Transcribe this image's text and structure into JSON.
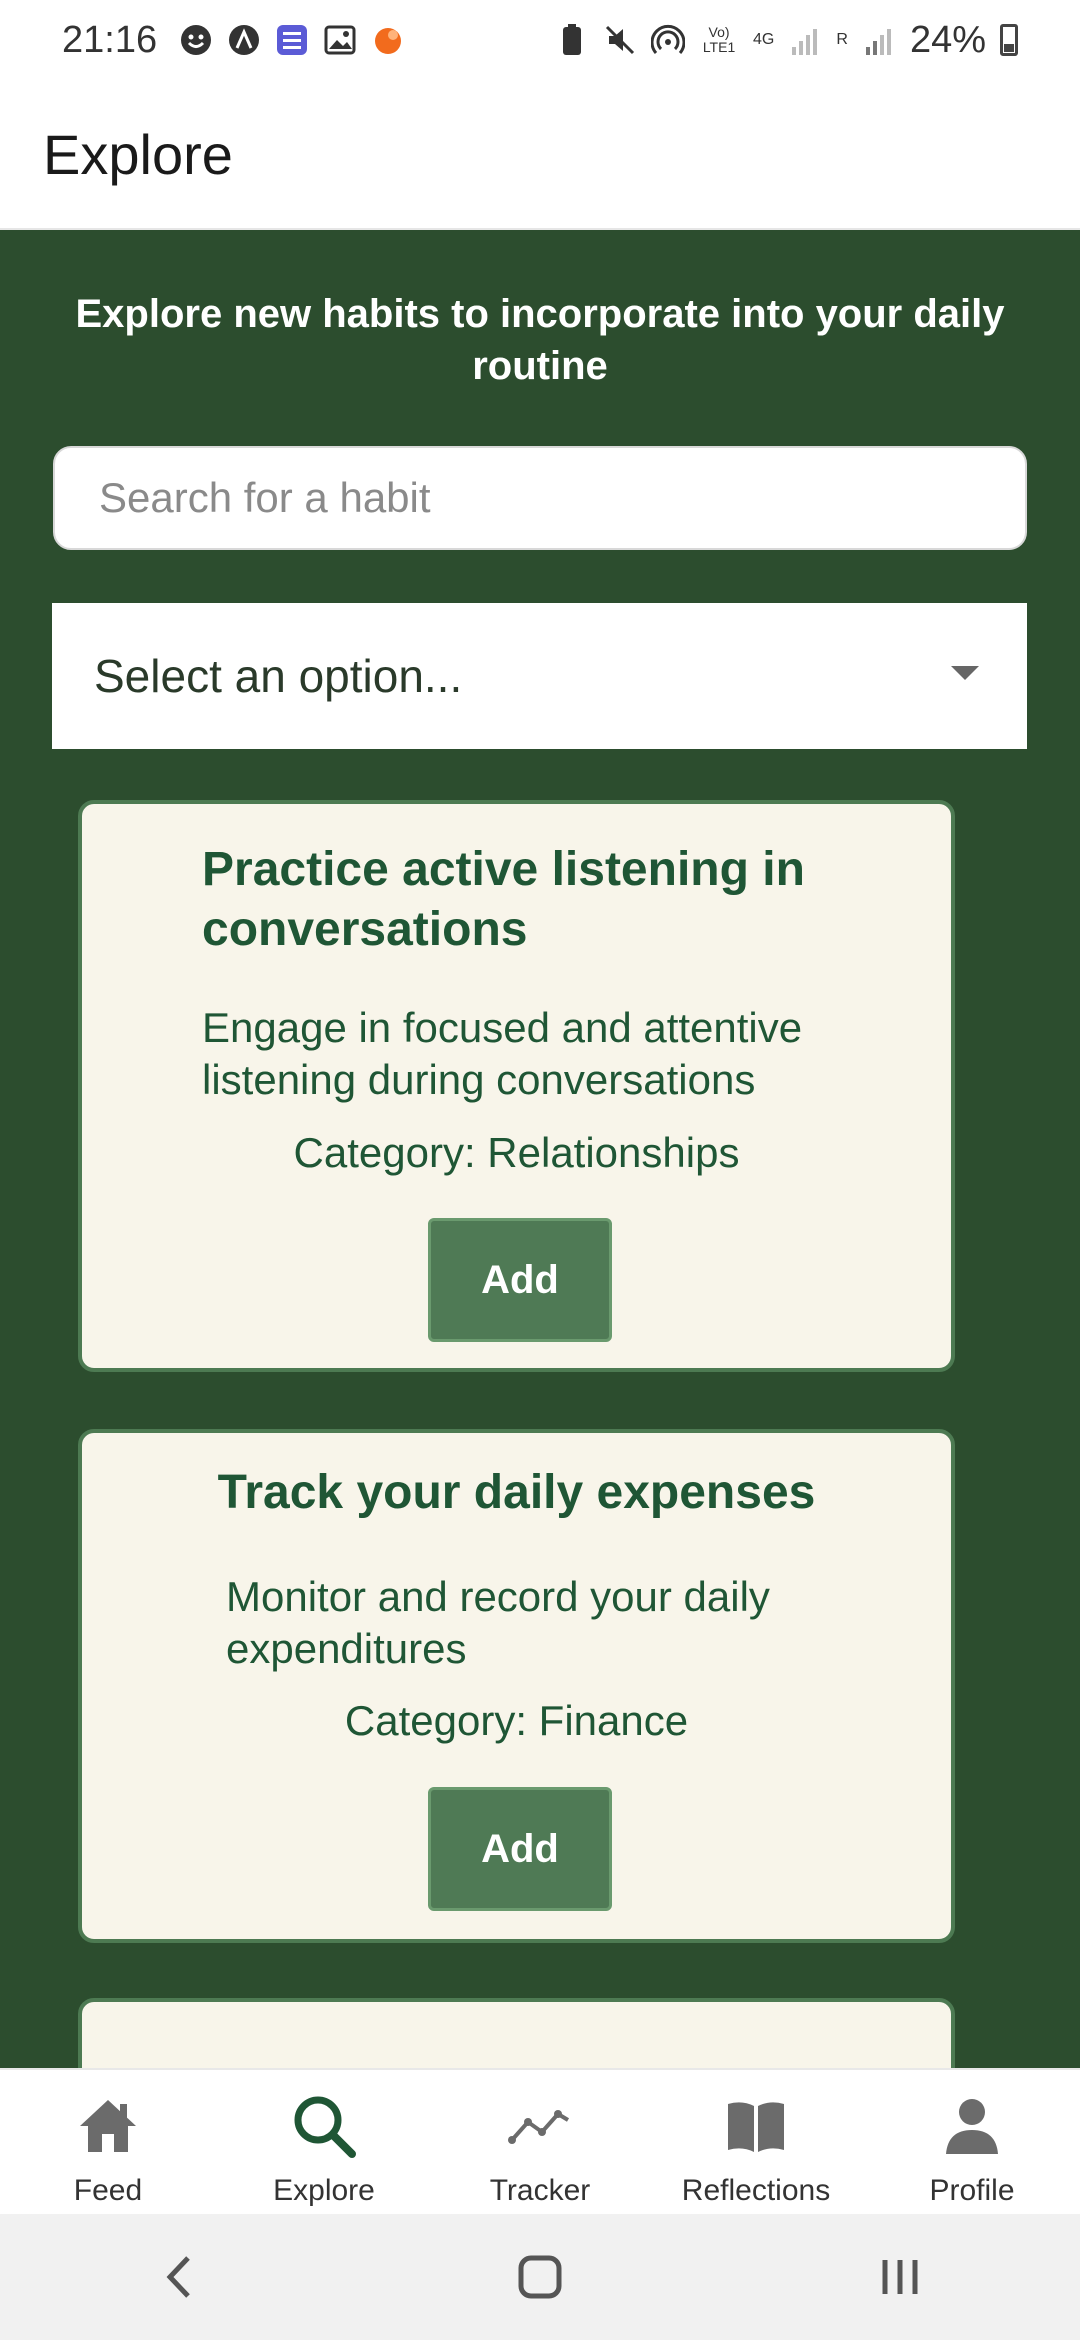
{
  "status_bar": {
    "time": "21:16",
    "signal_lte": "Vo) LTE1",
    "network": "4G",
    "roaming": "R",
    "battery": "24%"
  },
  "header": {
    "title": "Explore"
  },
  "intro_text": "Explore new habits to incorporate into your daily routine",
  "search": {
    "placeholder": "Search for a habit",
    "value": ""
  },
  "filter": {
    "selected": "Select an option..."
  },
  "habits": [
    {
      "title": "Practice active listening in conversations",
      "description": "Engage in focused and attentive listening during conversations",
      "category": "Category: Relationships",
      "button": "Add"
    },
    {
      "title": "Track your daily expenses",
      "description": "Monitor and record your daily expenditures",
      "category": "Category: Finance",
      "button": "Add"
    }
  ],
  "bottom_nav": {
    "items": [
      {
        "label": "Feed",
        "icon": "home-icon"
      },
      {
        "label": "Explore",
        "icon": "search-icon"
      },
      {
        "label": "Tracker",
        "icon": "trend-line-icon"
      },
      {
        "label": "Reflections",
        "icon": "book-icon"
      },
      {
        "label": "Profile",
        "icon": "person-icon"
      }
    ],
    "active": "Explore"
  },
  "colors": {
    "content_bg": "#2c4d2e",
    "card_bg": "#f8f5ea",
    "accent_green": "#1f5635",
    "button_bg": "#4f7a55"
  }
}
